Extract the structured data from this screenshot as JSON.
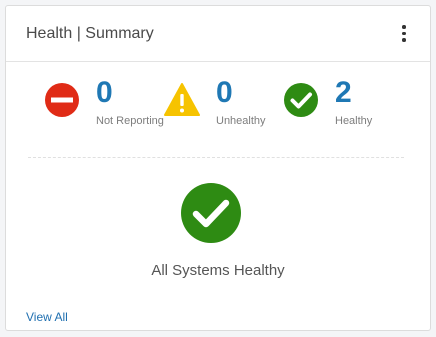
{
  "card": {
    "title": "Health | Summary",
    "menu_icon": "kebab-menu-icon"
  },
  "stats": [
    {
      "icon": "no-entry-icon",
      "count": "0",
      "label": "Not Reporting",
      "color": "#e02b16"
    },
    {
      "icon": "warning-triangle-icon",
      "count": "0",
      "label": "Unhealthy",
      "color": "#f6c300"
    },
    {
      "icon": "check-circle-icon",
      "count": "2",
      "label": "Healthy",
      "color": "#2e8b13"
    }
  ],
  "summary": {
    "icon": "check-circle-icon",
    "text": "All Systems Healthy"
  },
  "footer": {
    "view_all_label": "View All"
  },
  "colors": {
    "count_blue": "#1f78b4",
    "link_blue": "#1f6fb0"
  }
}
